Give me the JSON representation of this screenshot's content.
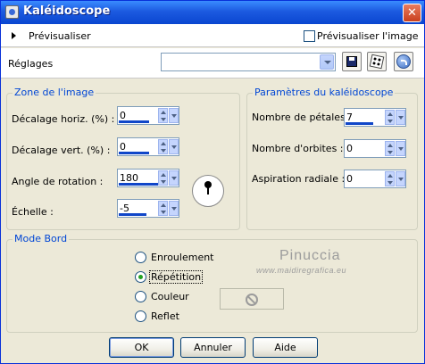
{
  "window": {
    "title": "Kaléidoscope",
    "close_glyph": "✕"
  },
  "preview": {
    "label": "Prévisualiser",
    "checkbox_label": "Prévisualiser l'image",
    "checkbox_checked": false
  },
  "settings": {
    "label": "Réglages",
    "value": "",
    "save_icon": "floppy-icon",
    "randomize_icon": "dice-icon",
    "reset_icon": "reset-icon"
  },
  "zone": {
    "title": "Zone de l'image",
    "fields": [
      {
        "label": "Décalage horiz. (%) :",
        "value": "0",
        "level": 0.5
      },
      {
        "label": "Décalage vert. (%) :",
        "value": "0",
        "level": 0.5
      },
      {
        "label": "Angle de rotation :",
        "value": "180",
        "level": 0.75
      },
      {
        "label": "Échelle :",
        "value": "-5",
        "level": 0.45
      }
    ]
  },
  "params": {
    "title": "Paramètres du kaléidoscope",
    "fields": [
      {
        "label": "Nombre de pétales :",
        "value": "7",
        "level": 0.45
      },
      {
        "label": "Nombre d'orbites :",
        "value": "0",
        "level": 0
      },
      {
        "label": "Aspiration radiale :",
        "value": "0",
        "level": 0
      }
    ]
  },
  "mode": {
    "title": "Mode Bord",
    "options": [
      "Enroulement",
      "Répétition",
      "Couleur",
      "Reflet"
    ],
    "selected": "Répétition"
  },
  "watermark": {
    "name": "Pinuccia",
    "url": "www.maidiregrafica.eu"
  },
  "buttons": {
    "ok": "OK",
    "cancel": "Annuler",
    "help": "Aide"
  }
}
